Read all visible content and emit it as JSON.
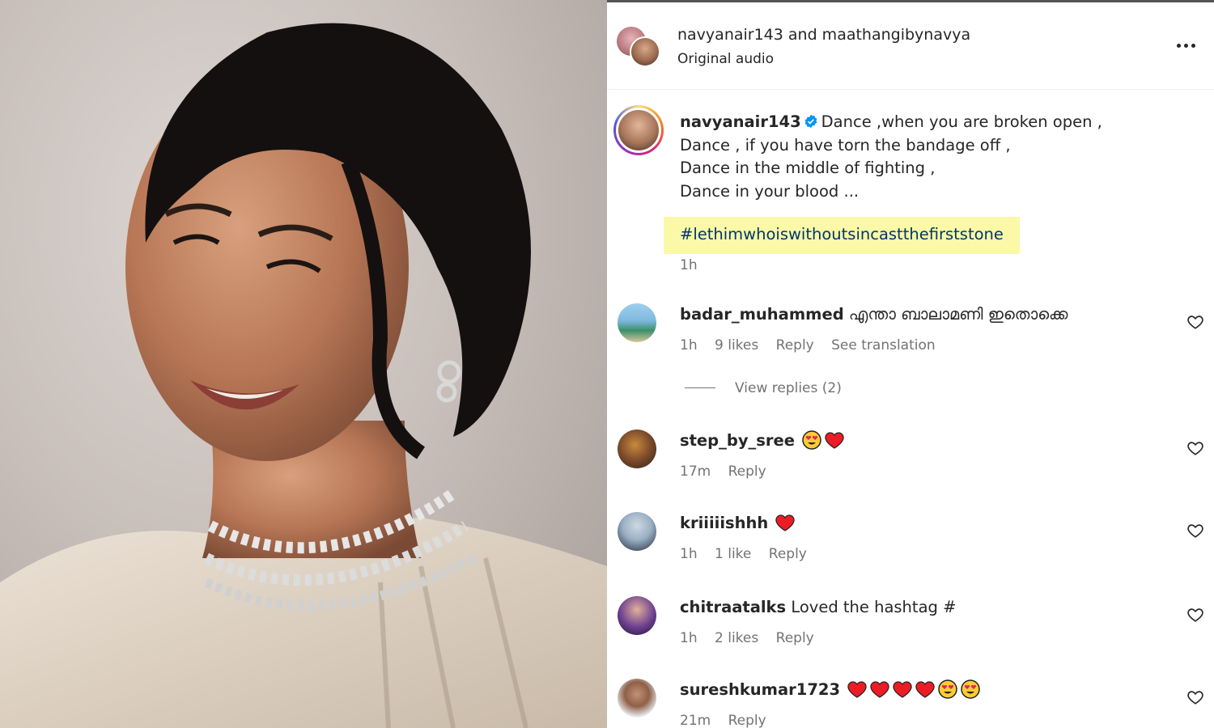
{
  "photo": {
    "alt": ""
  },
  "header": {
    "title": "navyanair143 and maathangibynavya",
    "subtitle": "Original audio"
  },
  "caption": {
    "username": "navyanair143",
    "lines": [
      "Dance ,when you are broken open ,",
      "Dance , if you have torn the bandage off ,",
      "Dance in the middle of fighting ,",
      "Dance in your blood ..."
    ],
    "hashtag": "#lethimwhoiswithoutsincastthefirststone",
    "time": "1h"
  },
  "comments": [
    {
      "username": "badar_muhammed",
      "text": "എന്താ ബാലാമണി ഇതൊക്കെ",
      "time": "1h",
      "likes": "9 likes",
      "reply": "Reply",
      "translate": "See translation"
    },
    {
      "username": "step_by_sree",
      "text": "",
      "time": "17m",
      "likes": "",
      "reply": "Reply"
    },
    {
      "username": "kriiiiishhh",
      "text": "",
      "time": "1h",
      "likes": "1 like",
      "reply": "Reply"
    },
    {
      "username": "chitraatalks",
      "text": "Loved the hashtag #",
      "time": "1h",
      "likes": "2 likes",
      "reply": "Reply"
    },
    {
      "username": "sureshkumar1723",
      "text": "",
      "time": "21m",
      "likes": "",
      "reply": "Reply"
    }
  ],
  "view_replies": "View replies (2)",
  "colors": {
    "accent_blue": "#0095f6",
    "hashtag_highlight": "#fbf8a8",
    "heart_red": "#ed1c24",
    "muted_text": "#737373"
  },
  "icons": [
    "more-icon",
    "verified-badge-icon",
    "heart-outline-icon",
    "heart-eyes-emoji-icon",
    "red-heart-emoji-icon"
  ]
}
